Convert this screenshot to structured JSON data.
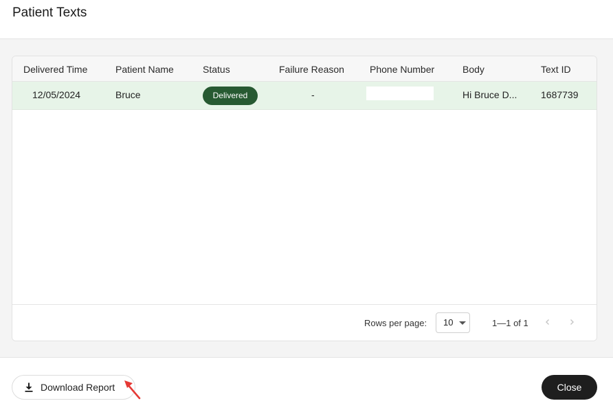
{
  "dialog": {
    "title": "Patient Texts"
  },
  "table": {
    "columns": {
      "delivered_time": "Delivered Time",
      "patient_name": "Patient Name",
      "status": "Status",
      "failure_reason": "Failure Reason",
      "phone_number": "Phone Number",
      "body": "Body",
      "text_id": "Text ID"
    },
    "rows": [
      {
        "delivered_time": "12/05/2024",
        "patient_name": "Bruce",
        "status": "Delivered",
        "failure_reason": "-",
        "phone_number": "",
        "body": "Hi Bruce D...",
        "text_id": "1687739"
      }
    ],
    "pagination": {
      "rows_per_page_label": "Rows per page:",
      "rows_per_page_value": "10",
      "range_text": "1—1 of 1"
    }
  },
  "footer": {
    "download_label": "Download Report",
    "close_label": "Close"
  },
  "colors": {
    "status_delivered": "#275a32",
    "row_highlight": "#e7f4e8",
    "annotation_arrow": "#e53935",
    "close_button": "#1e1e1e"
  },
  "icons": {
    "download": "download-icon",
    "prev": "chevron-left-icon",
    "next": "chevron-right-icon",
    "dropdown": "caret-down-icon"
  }
}
